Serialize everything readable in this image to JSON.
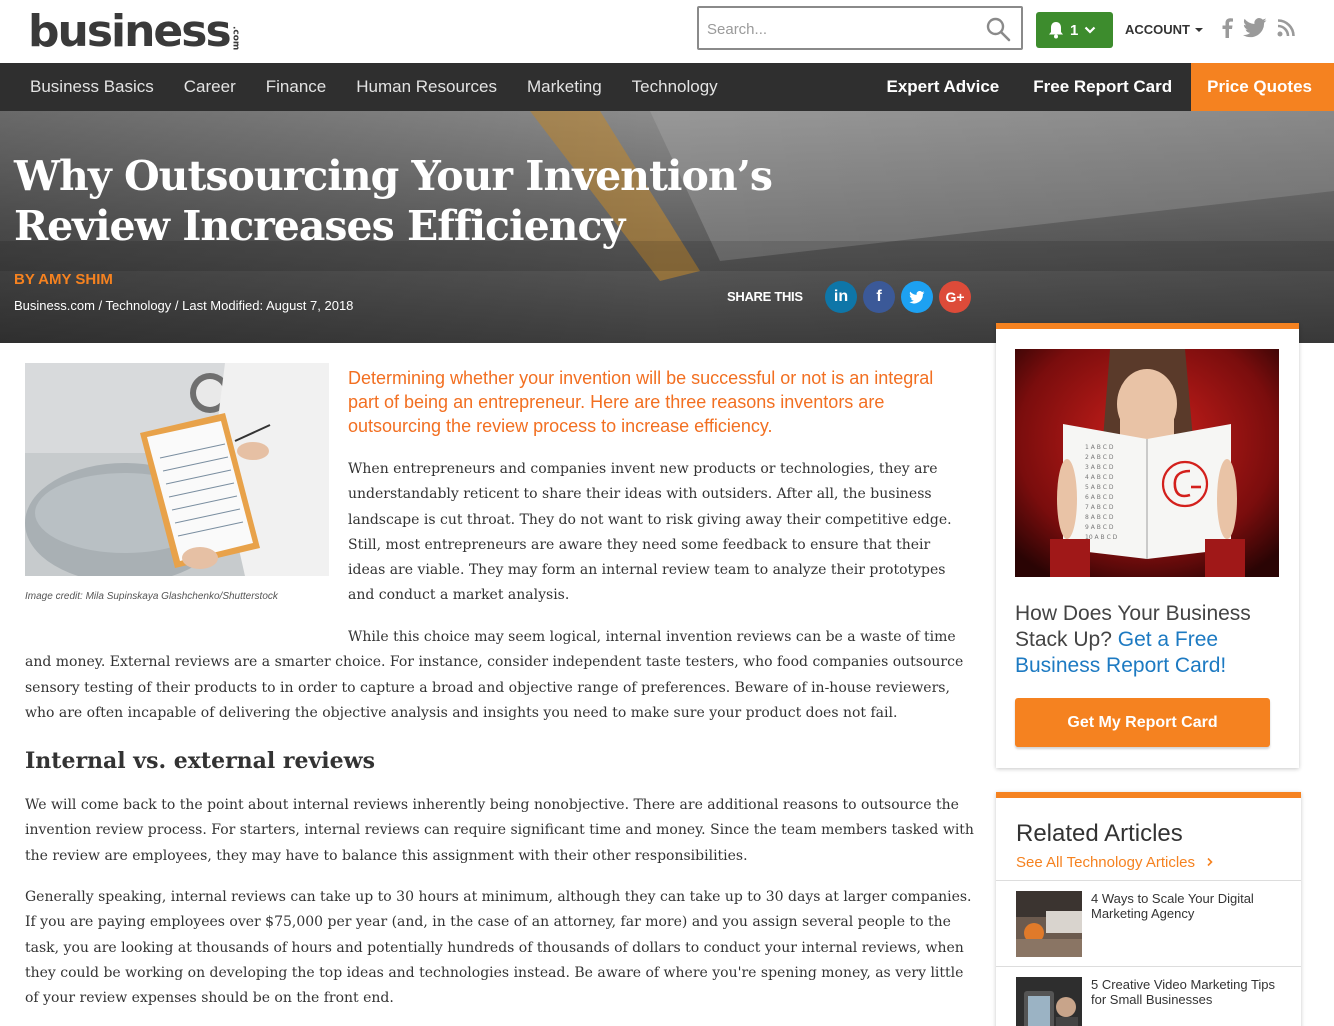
{
  "header": {
    "logo_text": "business",
    "logo_suffix": ".com",
    "search_placeholder": "Search...",
    "notification_count": "1",
    "account_label": "ACCOUNT"
  },
  "nav": {
    "left": [
      "Business Basics",
      "Career",
      "Finance",
      "Human Resources",
      "Marketing",
      "Technology"
    ],
    "right": [
      "Expert Advice",
      "Free Report Card",
      "Price Quotes"
    ]
  },
  "hero": {
    "title": "Why Outsourcing Your Invention’s Review Increases Efficiency",
    "byline": "BY AMY SHIM",
    "breadcrumb": "Business.com / Technology / Last Modified: August 7, 2018",
    "share_label": "SHARE THIS",
    "share_icons": [
      "in",
      "f",
      "t",
      "G+"
    ]
  },
  "article": {
    "image_credit": "Image credit: Mila Supinskaya Glashchenko/Shutterstock",
    "intro": "Determining whether your invention will be successful or not is an integral part of being an entrepreneur. Here are three reasons inventors are outsourcing the review process to increase efficiency.",
    "p1": "When entrepreneurs and companies invent new products or technologies, they are understandably reticent to share their ideas with outsiders. After all, the business landscape is cut throat. They do not want to risk giving away their competitive edge. Still, most entrepreneurs are aware they need some feedback to ensure that their ideas are viable. They may form an internal review team to analyze their prototypes and conduct a market analysis.",
    "p2": "While this choice may seem logical, internal invention reviews can be a waste of time and money. External reviews are a smarter choice. For instance, consider independent taste testers, who food companies outsource sensory testing of their products to in order to capture a broad and objective range of preferences. Beware of in-house reviewers, who are often incapable of delivering the objective analysis and insights you need to make sure your product does not fail.",
    "heading": "Internal vs. external reviews",
    "p3": "We will come back to the point about internal reviews inherently being nonobjective. There are additional reasons to outsource the invention review process. For starters, internal reviews can require significant time and money. Since the team members tasked with the review are employees, they may have to balance this assignment with their other responsibilities.",
    "p4": "Generally speaking, internal reviews can take up to 30 hours at minimum, although they can take up to 30 days at larger companies. If you are paying employees over $75,000 per year (and, in the case of an attorney, far more) and you assign several people to the task, you are looking at thousands of hours and potentially hundreds of thousands of dollars to conduct your internal reviews, when they could be working on developing the top ideas and technologies instead. Be aware of where you're spening money, as very little of your review expenses should be on the front end."
  },
  "sidebar": {
    "promo_text": "How Does Your Business Stack Up?",
    "promo_link": "Get a Free Business Report Card!",
    "promo_button": "Get My Report Card",
    "related_title": "Related Articles",
    "see_all": "See All Technology Articles",
    "related": [
      {
        "title": "4 Ways to Scale Your Digital Marketing Agency"
      },
      {
        "title": "5 Creative Video Marketing Tips for Small Businesses"
      }
    ]
  },
  "colors": {
    "accent": "#f58220",
    "nav_bg": "#2f2f2f",
    "link": "#1d7ac2",
    "notif": "#3d8c2d"
  }
}
